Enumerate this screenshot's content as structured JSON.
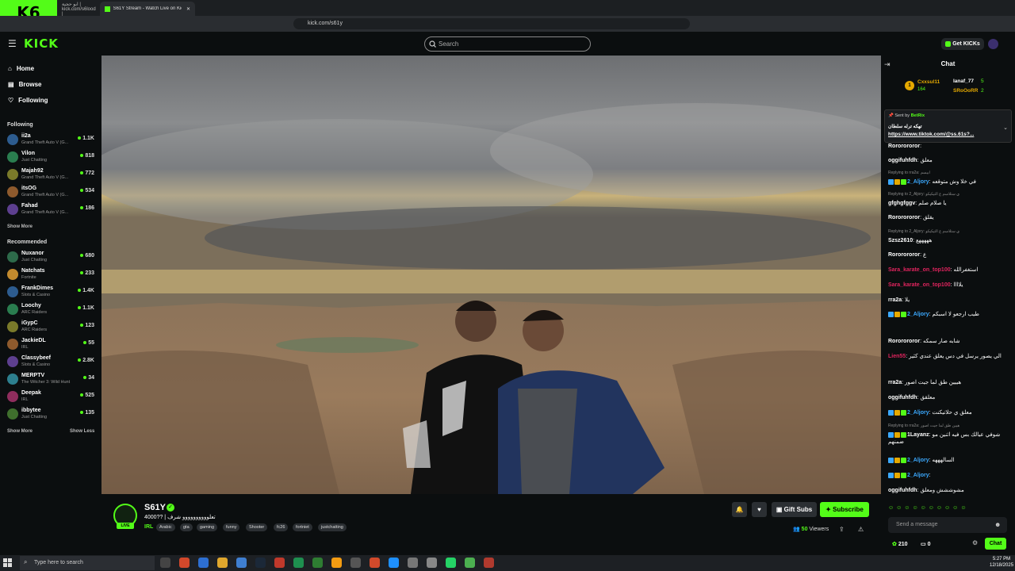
{
  "browser": {
    "logo_text": "6",
    "tab1_title": "ابو حجية | kick.com/s6lood |",
    "tab2_title": "S61Y Stream - Watch Live on Kick",
    "url": "kick.com/s61y"
  },
  "header": {
    "brand": "KICK",
    "search_placeholder": "Search",
    "get_kicks": "Get KICKs"
  },
  "sidebar": {
    "nav": [
      "Home",
      "Browse",
      "Following"
    ],
    "following_title": "Following",
    "following": [
      {
        "name": "ii2a",
        "category": "Grand Theft Auto V (G...",
        "viewers": "1.1K"
      },
      {
        "name": "Vilon",
        "category": "Just Chatting",
        "viewers": "818"
      },
      {
        "name": "Majah92",
        "category": "Grand Theft Auto V (G...",
        "viewers": "772"
      },
      {
        "name": "itsOG",
        "category": "Grand Theft Auto V (G...",
        "viewers": "534"
      },
      {
        "name": "Fahad",
        "category": "Grand Theft Auto V (G...",
        "viewers": "186"
      }
    ],
    "show_more": "Show More",
    "recommended_title": "Recommended",
    "recommended": [
      {
        "name": "Nuxanor",
        "category": "Just Chatting",
        "viewers": "680"
      },
      {
        "name": "Natchats",
        "category": "Fortnite",
        "viewers": "233"
      },
      {
        "name": "FrankDimes",
        "category": "Slots & Casino",
        "viewers": "1.4K"
      },
      {
        "name": "Loochy",
        "category": "ARC Raiders",
        "viewers": "1.1K"
      },
      {
        "name": "iGypC",
        "category": "ARC Raiders",
        "viewers": "123"
      },
      {
        "name": "JackieDL",
        "category": "IRL",
        "viewers": "55"
      },
      {
        "name": "Classybeef",
        "category": "Slots & Casino",
        "viewers": "2.8K"
      },
      {
        "name": "MERPTV",
        "category": "The Witcher 3: Wild Hunt",
        "viewers": "34"
      },
      {
        "name": "Deepak",
        "category": "IRL",
        "viewers": "525"
      },
      {
        "name": "ibbytee",
        "category": "Just Chatting",
        "viewers": "135"
      }
    ],
    "show_more2": "Show More",
    "show_less": "Show Less"
  },
  "stream": {
    "live": "LIVE",
    "name": "S61Y",
    "title": "4000?? | تعلوووووووووو شرف",
    "category": "IRL",
    "tags": [
      "Arabic",
      "gta",
      "gaming",
      "funny",
      "Shooter",
      "fc26",
      "fortniet",
      "justchatting"
    ],
    "gift_subs": "Gift Subs",
    "subscribe": "Subscribe",
    "viewers_count": "50",
    "viewers_label": "Viewers"
  },
  "chat": {
    "title": "Chat",
    "leaderboard": [
      {
        "rank": "1",
        "name": "Cxxsul11",
        "value": "164"
      },
      {
        "name": "lanaf_77",
        "value": "5"
      },
      {
        "name": "SRoOoRR",
        "value": "2"
      }
    ],
    "pinned_sent_by": "Sent by",
    "pinned_user": "BetRix",
    "pinned_text": "تهكه ترله سلطان",
    "pinned_link": "https://www.tiktok.com/@ss.61s?...",
    "messages": [
      {
        "type": "msg",
        "user": "Rororororor",
        "color": "#ffffff",
        "text": ""
      },
      {
        "type": "msg",
        "user": "oggifuhfdh",
        "color": "#ffffff",
        "text": "معلق"
      },
      {
        "type": "reply",
        "text": "Replying to rra2a: ابيسم"
      },
      {
        "type": "msg",
        "user": "2_Aljory",
        "color": "#3ba9ff",
        "text": "في خلا وش متوقعه",
        "badges": true
      },
      {
        "type": "reply",
        "text": "Replying to 2_Aljory: ي ستلاسم ع التيكيكو"
      },
      {
        "type": "msg",
        "user": "gfghgfggv",
        "color": "#ffffff",
        "text": "يا صلام صلم"
      },
      {
        "type": "msg",
        "user": "Rororororor",
        "color": "#ffffff",
        "text": "يقلق"
      },
      {
        "type": "reply",
        "text": "Replying to 2_Aljory: ي ستلاسم ع التيكيكو"
      },
      {
        "type": "msg",
        "user": "Szsz2610",
        "color": "#ffffff",
        "text": "هههههع"
      },
      {
        "type": "msg",
        "user": "Rororororor",
        "color": "#ffffff",
        "text": "ع"
      },
      {
        "type": "msg",
        "user": "Sara_karate_on_top100",
        "color": "#e0245e",
        "text": "استغفرالله"
      },
      {
        "type": "msg",
        "user": "Sara_karate_on_top100",
        "color": "#e0245e",
        "text": "يلاااا"
      },
      {
        "type": "msg",
        "user": "rra2a",
        "color": "#ffffff",
        "text": "يلا"
      },
      {
        "type": "msg",
        "user": "2_Aljory",
        "color": "#3ba9ff",
        "text": "طيب ارجعو لا اسبكم",
        "badges": true
      },
      {
        "type": "msg",
        "user": "Rororororor",
        "color": "#ffffff",
        "text": "شابه صار سمكه"
      },
      {
        "type": "msg",
        "user": "Lien55",
        "color": "#e0245e",
        "text": "الي يصور يرسل في دس يعلق عندي كثير"
      },
      {
        "type": "msg",
        "user": "rra2a",
        "color": "#ffffff",
        "text": "هييين طق لما جيت اصور"
      },
      {
        "type": "msg",
        "user": "oggifuhfdh",
        "color": "#ffffff",
        "text": "معلقق"
      },
      {
        "type": "msg",
        "user": "2_Aljory",
        "color": "#3ba9ff",
        "text": "معلق ي حلاتيكنت",
        "badges": true
      },
      {
        "type": "reply",
        "text": "Replying to rra2a: هيين طق لما جيت اصور"
      },
      {
        "type": "msg",
        "user": "1Layanz",
        "color": "#ffffff",
        "text": "شوفي عيالك بس فيه اثنين مو ضمنهم",
        "badges": true
      },
      {
        "type": "msg",
        "user": "2_Aljory",
        "color": "#3ba9ff",
        "text": "السالهههه",
        "badges": true
      },
      {
        "type": "msg",
        "user": "2_Aljory",
        "color": "#3ba9ff",
        "text": "",
        "badges": true
      },
      {
        "type": "msg",
        "user": "oggifuhfdh",
        "color": "#ffffff",
        "text": "مشوششش ومعلق"
      }
    ],
    "send_placeholder": "Send a message",
    "points": "210",
    "zero": "0",
    "chat_button": "Chat"
  },
  "taskbar": {
    "search_placeholder": "Type here to search",
    "time": "5:27 PM",
    "date": "12/18/2025"
  },
  "colors": {
    "accent": "#53fc18",
    "bg": "#0b0e0f"
  }
}
